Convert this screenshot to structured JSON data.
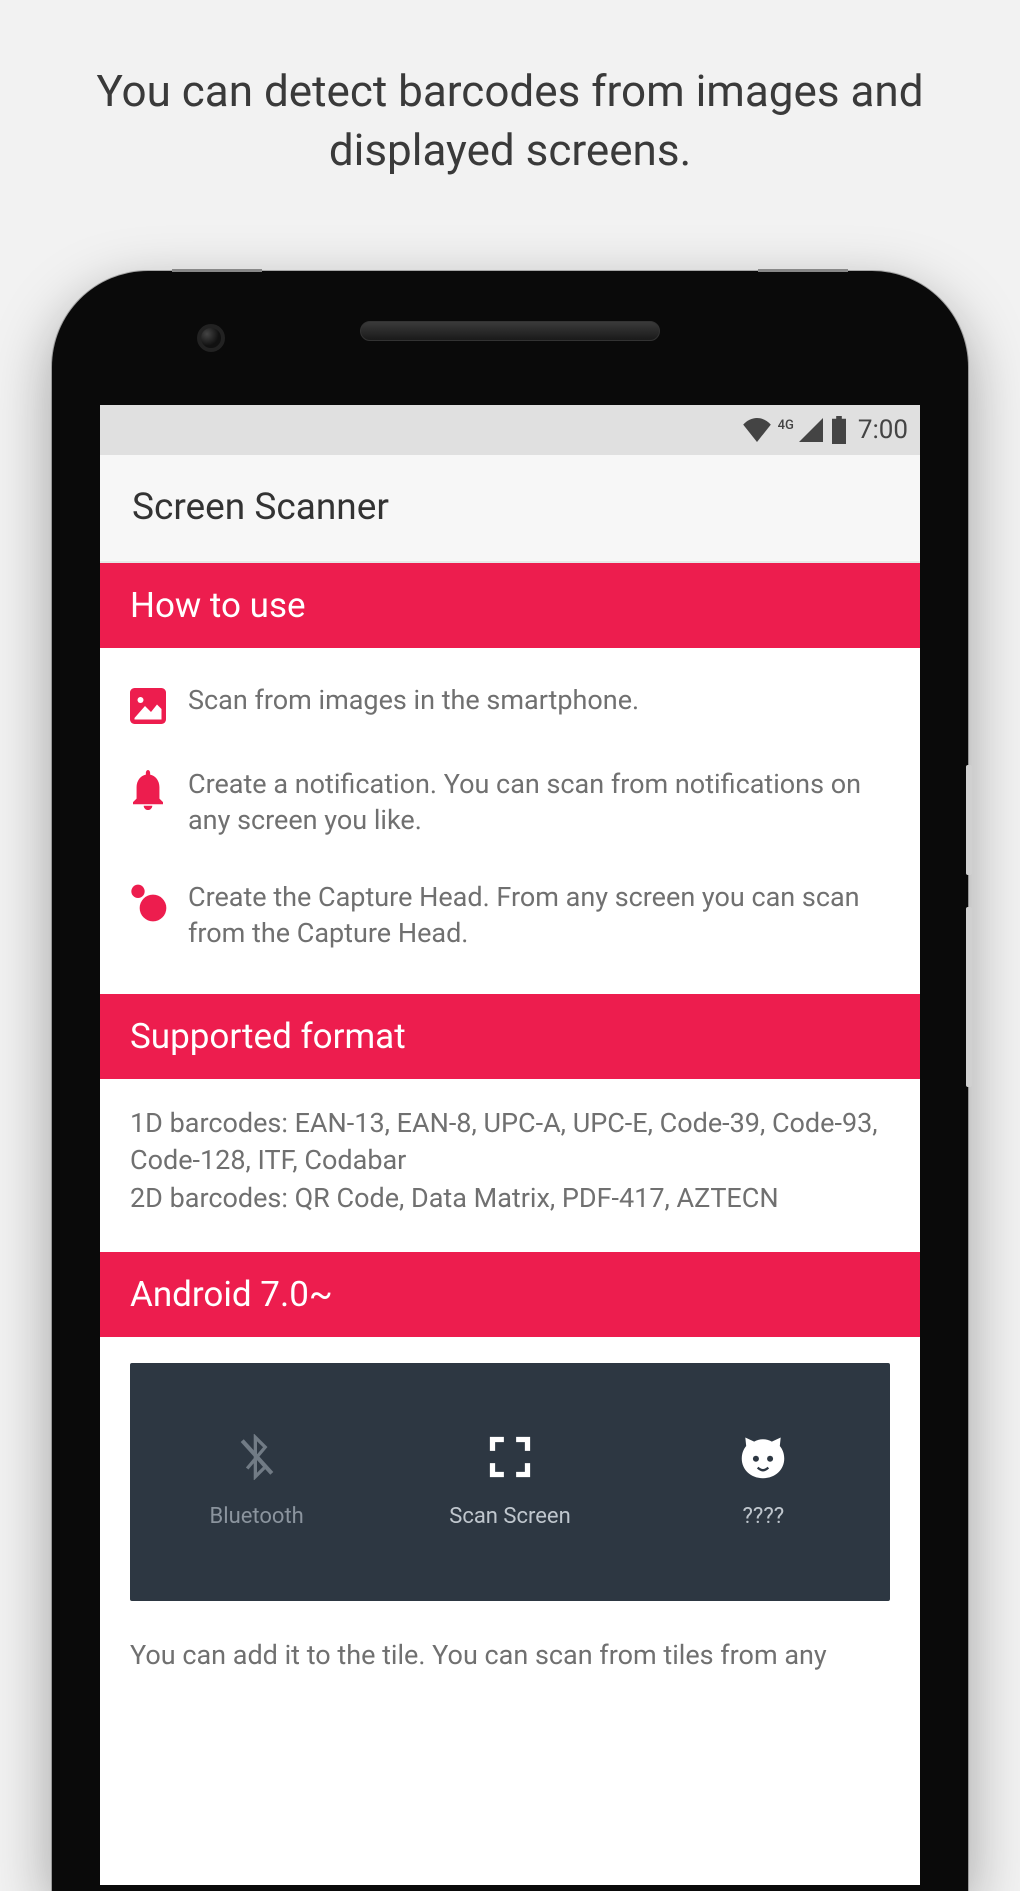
{
  "promo": {
    "headline": "You can detect barcodes from images and displayed screens."
  },
  "status": {
    "network_label": "4G",
    "time": "7:00"
  },
  "app": {
    "title": "Screen Scanner"
  },
  "sections": {
    "how_to_use": {
      "title": "How to use",
      "items": [
        {
          "icon": "image-icon",
          "text": "Scan from images in the smartphone."
        },
        {
          "icon": "bell-icon",
          "text": "Create a notification. You can scan from notifications on any screen you like."
        },
        {
          "icon": "bubbles-icon",
          "text": "Create the Capture Head. From any screen you can scan from the Capture Head."
        }
      ]
    },
    "supported_format": {
      "title": "Supported format",
      "line1": "1D barcodes: EAN-13, EAN-8, UPC-A, UPC-E, Code-39, Code-93, Code-128, ITF, Codabar",
      "line2": "2D barcodes: QR Code, Data Matrix, PDF-417, AZTECN"
    },
    "android": {
      "title": "Android 7.0~",
      "tiles": [
        {
          "icon": "bluetooth-off-icon",
          "label": "Bluetooth"
        },
        {
          "icon": "scan-icon",
          "label": "Scan Screen"
        },
        {
          "icon": "cat-icon",
          "label": "????"
        }
      ],
      "after_text": "You can add it to the tile. You can scan from tiles from any"
    }
  }
}
